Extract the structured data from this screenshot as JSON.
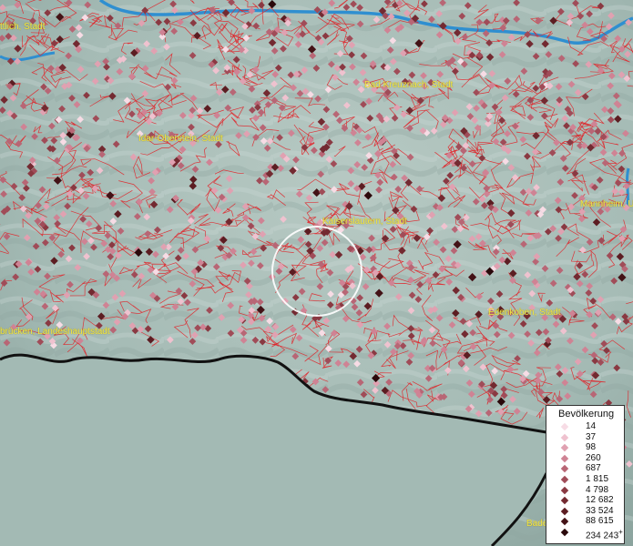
{
  "map": {
    "cities": [
      {
        "label": "ttlich, Stadt"
      },
      {
        "label": "Bad Kreuznach, Stadt"
      },
      {
        "label": "Idar-Oberstein, Stadt"
      },
      {
        "label": "Kaiserslautern, Stadt"
      },
      {
        "label": "Mannheim, U"
      },
      {
        "label": "brücken, Landeshauptstadt"
      },
      {
        "label": "Edenkoben, Stadt"
      },
      {
        "label": "Bade"
      }
    ]
  },
  "legend": {
    "title": "Bevölkerung",
    "items": [
      {
        "label": "14",
        "color": "#f7dce5"
      },
      {
        "label": "37",
        "color": "#efc2cf"
      },
      {
        "label": "98",
        "color": "#e0a1b1"
      },
      {
        "label": "260",
        "color": "#cf8394"
      },
      {
        "label": "687",
        "color": "#b86675"
      },
      {
        "label": "1 815",
        "color": "#a04c58"
      },
      {
        "label": "4 798",
        "color": "#8a3942"
      },
      {
        "label": "12 682",
        "color": "#732a31"
      },
      {
        "label": "33 524",
        "color": "#5c1d22"
      },
      {
        "label": "88 615",
        "color": "#431216"
      },
      {
        "label": "234 243",
        "color": "#2a090b",
        "superscript": "+"
      }
    ]
  },
  "colors": {
    "terrain": "#9fb7b1",
    "boundaries": "#e0252a",
    "river": "#2f8fd0",
    "border": "#111111",
    "city_label": "#f2e84a"
  }
}
